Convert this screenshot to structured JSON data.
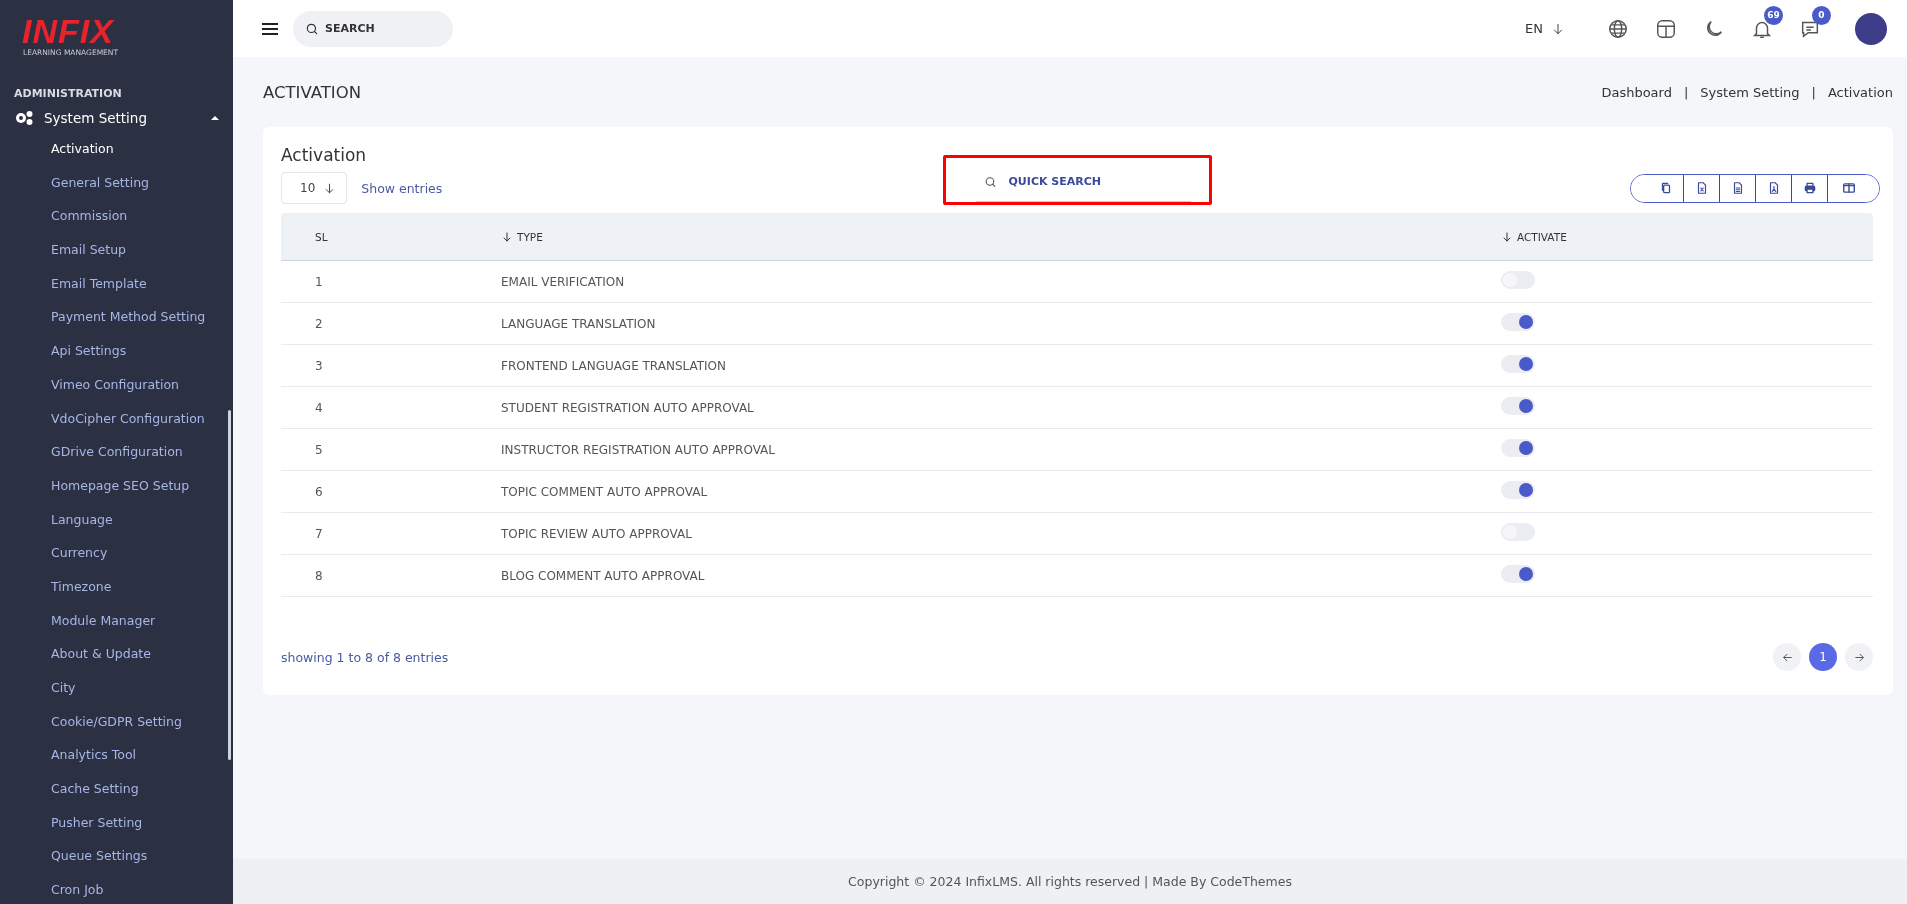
{
  "logo": {
    "brand": "INFIX",
    "tagline": "LEARNING MANAGEMENT"
  },
  "sidebar": {
    "section": "ADMINISTRATION",
    "group": {
      "label": "System Setting",
      "expanded": true
    },
    "items": [
      {
        "label": "Activation",
        "selected": true
      },
      {
        "label": "General Setting",
        "selected": false
      },
      {
        "label": "Commission",
        "selected": false
      },
      {
        "label": "Email Setup",
        "selected": false
      },
      {
        "label": "Email Template",
        "selected": false
      },
      {
        "label": "Payment Method Setting",
        "selected": false
      },
      {
        "label": "Api Settings",
        "selected": false
      },
      {
        "label": "Vimeo Configuration",
        "selected": false
      },
      {
        "label": "VdoCipher Configuration",
        "selected": false
      },
      {
        "label": "GDrive Configuration",
        "selected": false
      },
      {
        "label": "Homepage SEO Setup",
        "selected": false
      },
      {
        "label": "Language",
        "selected": false
      },
      {
        "label": "Currency",
        "selected": false
      },
      {
        "label": "Timezone",
        "selected": false
      },
      {
        "label": "Module Manager",
        "selected": false
      },
      {
        "label": "About & Update",
        "selected": false
      },
      {
        "label": "City",
        "selected": false
      },
      {
        "label": "Cookie/GDPR Setting",
        "selected": false
      },
      {
        "label": "Analytics Tool",
        "selected": false
      },
      {
        "label": "Cache Setting",
        "selected": false
      },
      {
        "label": "Pusher Setting",
        "selected": false
      },
      {
        "label": "Queue Settings",
        "selected": false
      },
      {
        "label": "Cron Job",
        "selected": false
      }
    ]
  },
  "topbar": {
    "search_placeholder": "SEARCH",
    "language": "EN",
    "notifications": "69",
    "messages": "0"
  },
  "page": {
    "title": "ACTIVATION",
    "breadcrumbs": [
      "Dashboard",
      "System Setting",
      "Activation"
    ],
    "breadcrumb_separator": "|"
  },
  "card": {
    "title": "Activation",
    "page_size": "10",
    "show_entries": "Show entries",
    "quick_search": {
      "placeholder": "QUICK SEARCH",
      "highlighted": true
    },
    "export_buttons": [
      {
        "kind": "copy"
      },
      {
        "kind": "excel"
      },
      {
        "kind": "csv"
      },
      {
        "kind": "pdf"
      },
      {
        "kind": "print"
      },
      {
        "kind": "columns"
      }
    ]
  },
  "table": {
    "columns": [
      {
        "label": "SL",
        "sortable": false
      },
      {
        "label": "TYPE",
        "sortable": true
      },
      {
        "label": "ACTIVATE",
        "sortable": true
      }
    ],
    "rows": [
      {
        "sl": "1",
        "type": "EMAIL VERIFICATION",
        "activate": false
      },
      {
        "sl": "2",
        "type": "LANGUAGE TRANSLATION",
        "activate": true
      },
      {
        "sl": "3",
        "type": "FRONTEND LANGUAGE TRANSLATION",
        "activate": true
      },
      {
        "sl": "4",
        "type": "STUDENT REGISTRATION AUTO APPROVAL",
        "activate": true
      },
      {
        "sl": "5",
        "type": "INSTRUCTOR REGISTRATION AUTO APPROVAL",
        "activate": true
      },
      {
        "sl": "6",
        "type": "TOPIC COMMENT AUTO APPROVAL",
        "activate": true
      },
      {
        "sl": "7",
        "type": "TOPIC REVIEW AUTO APPROVAL",
        "activate": false
      },
      {
        "sl": "8",
        "type": "BLOG COMMENT AUTO APPROVAL",
        "activate": true
      }
    ]
  },
  "pagination": {
    "summary": "showing 1 to 8 of 8 entries",
    "pages": [
      {
        "label": "1",
        "selected": true
      }
    ]
  },
  "footer": "Copyright © 2024 InfixLMS. All rights reserved | Made By CodeThemes"
}
